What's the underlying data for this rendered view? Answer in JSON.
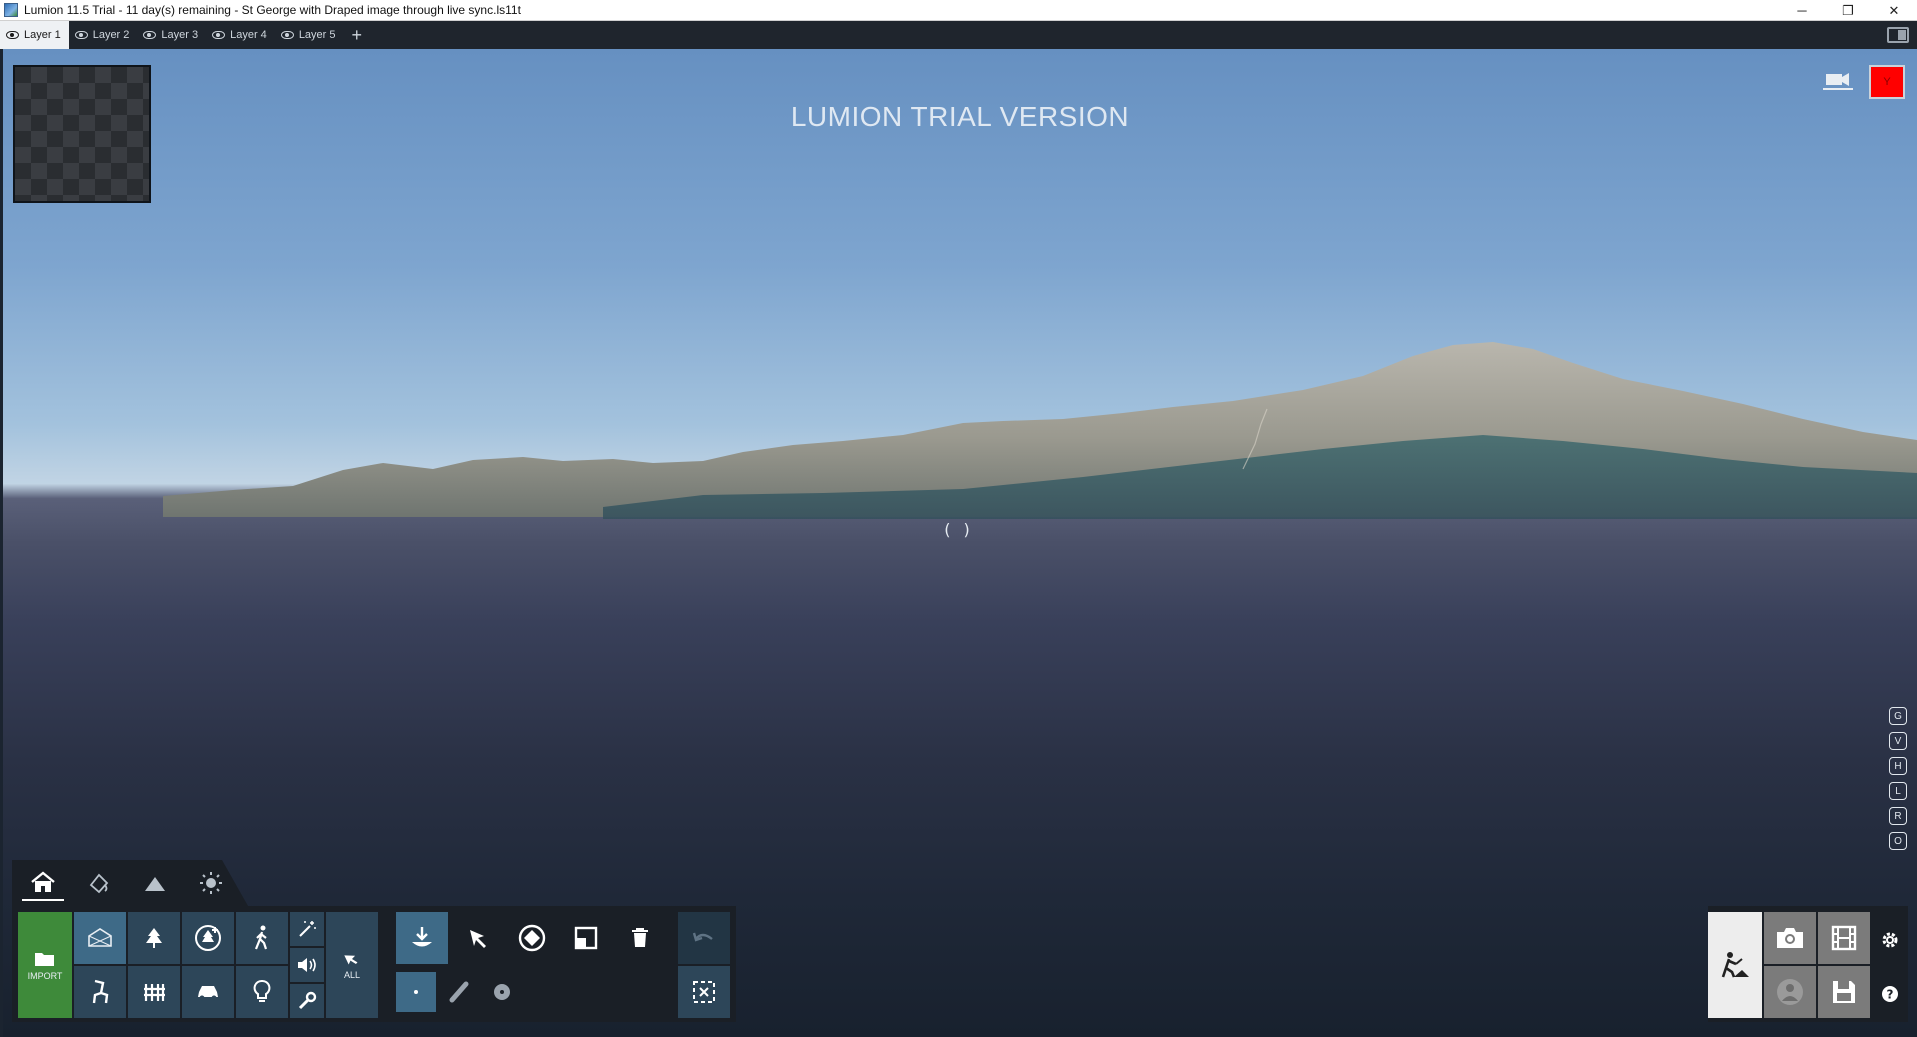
{
  "window": {
    "title": "Lumion 11.5 Trial - 11 day(s) remaining - St George with Draped image through live sync.ls11t",
    "controls": {
      "minimize": "─",
      "restore": "❐",
      "close": "✕"
    }
  },
  "layers": {
    "tabs": [
      {
        "label": "Layer 1",
        "active": true
      },
      {
        "label": "Layer 2",
        "active": false
      },
      {
        "label": "Layer 3",
        "active": false
      },
      {
        "label": "Layer 4",
        "active": false
      },
      {
        "label": "Layer 5",
        "active": false
      }
    ],
    "add_label": "+"
  },
  "viewport": {
    "watermark": "LUMION TRIAL VERSION",
    "crosshair": "( )",
    "indicator_label": "Y",
    "indicator_color": "#ff0000",
    "hotkeys": [
      "G",
      "V",
      "H",
      "L",
      "R",
      "O"
    ]
  },
  "toolbar": {
    "tabs": [
      "home-icon",
      "material-icon",
      "landscape-icon",
      "weather-icon"
    ],
    "import_label": "IMPORT",
    "all_label": "ALL",
    "accent_color": "#3e8a3a",
    "button_color": "#2d4659"
  },
  "modes": {
    "build": "build-mode-icon",
    "photo": "photo-mode-icon",
    "movie": "movie-mode-icon",
    "panorama": "panorama-mode-icon",
    "save": "save-icon"
  }
}
